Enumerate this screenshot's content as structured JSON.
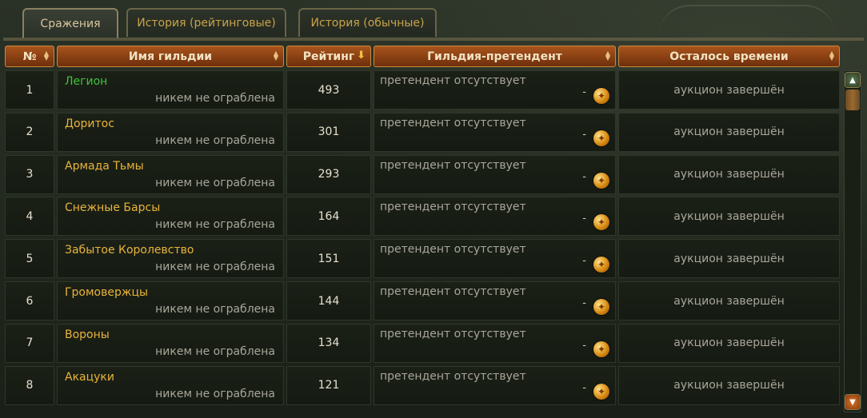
{
  "tabs": [
    {
      "label": "Сражения",
      "active": true
    },
    {
      "label": "История (рейтинговые)",
      "active": false
    },
    {
      "label": "История (обычные)",
      "active": false
    }
  ],
  "columns": {
    "num": "№",
    "guild": "Имя гильдии",
    "rating": "Рейтинг",
    "challenger": "Гильдия-претендент",
    "time_left": "Осталось времени"
  },
  "colors": {
    "header_bg": "#a8541c",
    "guild_name": "#e8b43a",
    "guild_name_highlight": "#3fc43a"
  },
  "rows": [
    {
      "num": "1",
      "guild": "Легион",
      "status": "никем не ограблена",
      "rating": "493",
      "challenger": "претендент отсутствует",
      "dash": "-",
      "time": "аукцион завершён",
      "highlight": true
    },
    {
      "num": "2",
      "guild": "Доритос",
      "status": "никем не ограблена",
      "rating": "301",
      "challenger": "претендент отсутствует",
      "dash": "-",
      "time": "аукцион завершён"
    },
    {
      "num": "3",
      "guild": "Армада Тьмы",
      "status": "никем не ограблена",
      "rating": "293",
      "challenger": "претендент отсутствует",
      "dash": "-",
      "time": "аукцион завершён"
    },
    {
      "num": "4",
      "guild": "Снежные Барсы",
      "status": "никем не ограблена",
      "rating": "164",
      "challenger": "претендент отсутствует",
      "dash": "-",
      "time": "аукцион завершён"
    },
    {
      "num": "5",
      "guild": "Забытое Королевство",
      "status": "никем не ограблена",
      "rating": "151",
      "challenger": "претендент отсутствует",
      "dash": "-",
      "time": "аукцион завершён"
    },
    {
      "num": "6",
      "guild": "Громовержцы",
      "status": "никем не ограблена",
      "rating": "144",
      "challenger": "претендент отсутствует",
      "dash": "-",
      "time": "аукцион завершён"
    },
    {
      "num": "7",
      "guild": "Вороны",
      "status": "никем не ограблена",
      "rating": "134",
      "challenger": "претендент отсутствует",
      "dash": "-",
      "time": "аукцион завершён"
    },
    {
      "num": "8",
      "guild": "Акацуки",
      "status": "никем не ограблена",
      "rating": "121",
      "challenger": "претендент отсутствует",
      "dash": "-",
      "time": "аукцион завершён"
    }
  ]
}
